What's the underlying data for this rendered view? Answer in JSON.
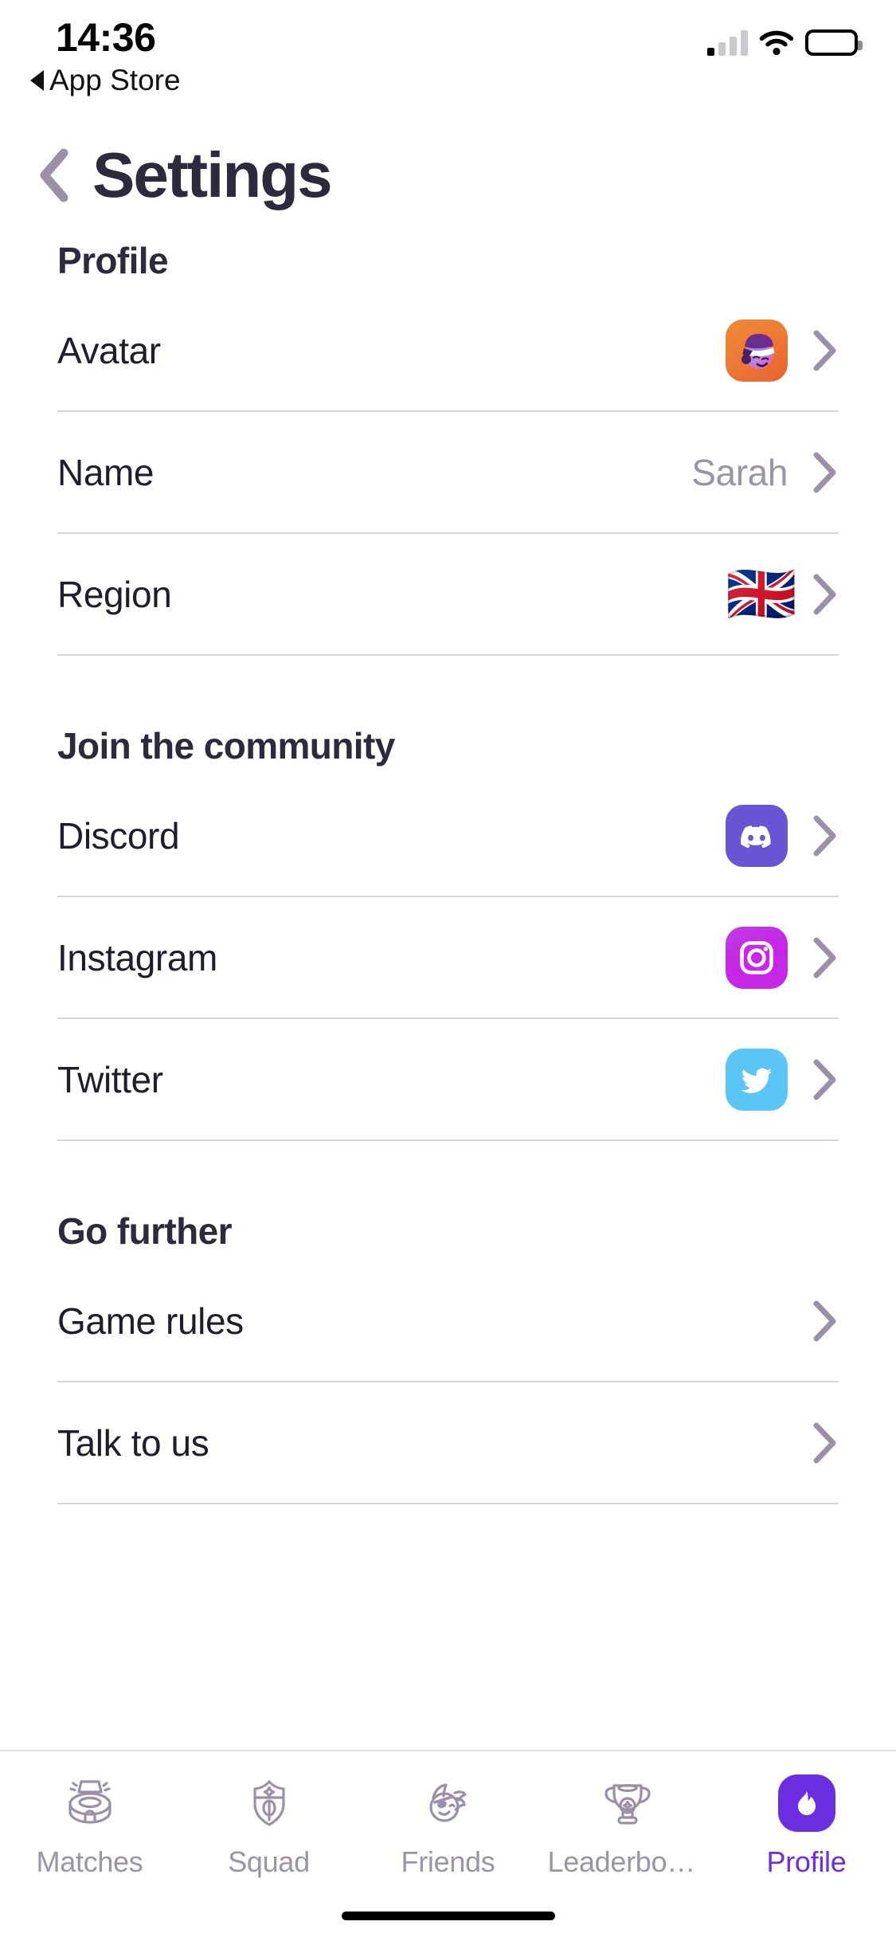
{
  "status_bar": {
    "time": "14:36",
    "back_app_label": "App Store",
    "back_app_icon": "triangle-left-icon",
    "signal_icon": "cellular-signal-icon",
    "wifi_icon": "wifi-icon",
    "battery_icon": "battery-icon"
  },
  "header": {
    "back_icon": "chevron-left-icon",
    "title": "Settings"
  },
  "sections": [
    {
      "title": "Profile",
      "rows": [
        {
          "label": "Avatar",
          "value": "",
          "accessory": "avatar-thumbnail",
          "chevron": "chevron-right-icon"
        },
        {
          "label": "Name",
          "value": "Sarah",
          "accessory": "none",
          "chevron": "chevron-right-icon"
        },
        {
          "label": "Region",
          "value": "",
          "accessory": "uk-flag",
          "flag": "🇬🇧",
          "chevron": "chevron-right-icon"
        }
      ]
    },
    {
      "title": "Join the community",
      "rows": [
        {
          "label": "Discord",
          "value": "",
          "accessory": "discord-icon",
          "chevron": "chevron-right-icon"
        },
        {
          "label": "Instagram",
          "value": "",
          "accessory": "instagram-icon",
          "chevron": "chevron-right-icon"
        },
        {
          "label": "Twitter",
          "value": "",
          "accessory": "twitter-icon",
          "chevron": "chevron-right-icon"
        }
      ]
    },
    {
      "title": "Go further",
      "rows": [
        {
          "label": "Game rules",
          "value": "",
          "accessory": "none",
          "chevron": "chevron-right-icon"
        },
        {
          "label": "Talk to us",
          "value": "",
          "accessory": "none",
          "chevron": "chevron-right-icon"
        }
      ]
    }
  ],
  "tabbar": {
    "items": [
      {
        "label": "Matches",
        "icon": "stadium-icon",
        "active": false
      },
      {
        "label": "Squad",
        "icon": "shield-icon",
        "active": false
      },
      {
        "label": "Friends",
        "icon": "face-eyepatch-icon",
        "active": false
      },
      {
        "label": "Leaderboa…",
        "icon": "trophy-icon",
        "active": false
      },
      {
        "label": "Profile",
        "icon": "flame-icon",
        "active": true
      }
    ]
  },
  "colors": {
    "title_text": "#2E2A3E",
    "row_text": "#201C2C",
    "muted_text": "#9B93A6",
    "divider": "#D8D4DD",
    "accent_purple": "#6B2EE0",
    "discord": "#6A54D6",
    "instagram": "#C724E8",
    "twitter": "#5BC5F5",
    "avatar_orange": "#EE7B36"
  }
}
